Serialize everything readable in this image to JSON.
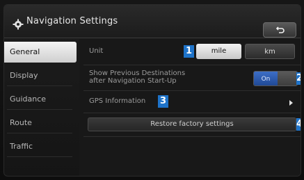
{
  "header": {
    "title": "Navigation Settings"
  },
  "sidebar": {
    "items": [
      {
        "label": "General",
        "active": true
      },
      {
        "label": "Display"
      },
      {
        "label": "Guidance"
      },
      {
        "label": "Route"
      },
      {
        "label": "Traffic"
      }
    ]
  },
  "settings": {
    "unit": {
      "label": "Unit",
      "options": [
        "mile",
        "km"
      ],
      "selected": "mile"
    },
    "previous_destinations": {
      "label_line1": "Show Previous Destinations",
      "label_line2": "after Navigation Start-Up",
      "toggle_label": "On",
      "state": "on"
    },
    "gps_information": {
      "label": "GPS Information"
    },
    "restore": {
      "label": "Restore factory settings"
    }
  },
  "badges": [
    "1",
    "2",
    "3",
    "4"
  ],
  "colors": {
    "badge": "#1e73c9",
    "toggle_on": "#2d5fb5"
  },
  "icons": {
    "title": "gear-icon",
    "back": "back-arrow-icon",
    "gps": "chevron-right-icon"
  }
}
